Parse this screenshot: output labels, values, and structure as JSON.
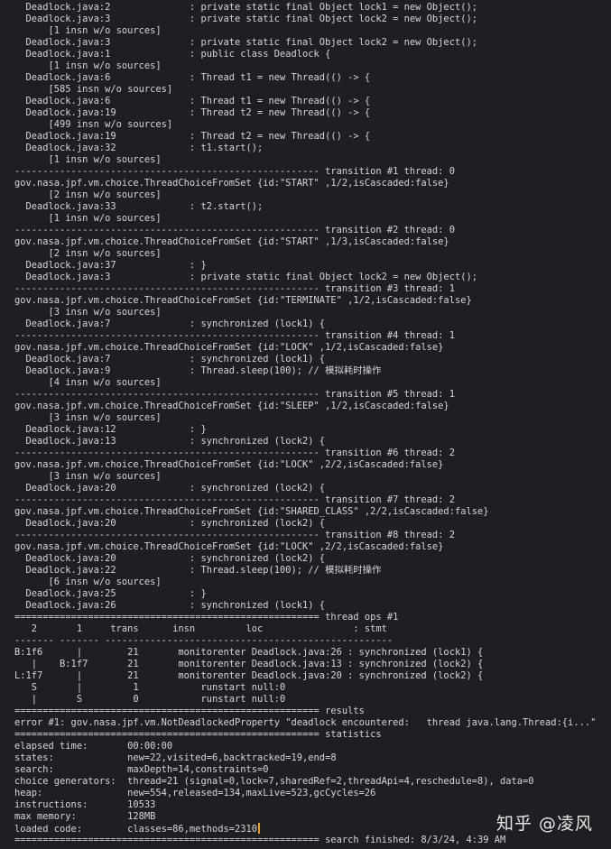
{
  "console": {
    "lines": [
      "  Deadlock.java:2              : private static final Object lock1 = new Object();",
      "  Deadlock.java:3              : private static final Object lock2 = new Object();",
      "      [1 insn w/o sources]",
      "  Deadlock.java:3              : private static final Object lock2 = new Object();",
      "  Deadlock.java:1              : public class Deadlock {",
      "      [1 insn w/o sources]",
      "  Deadlock.java:6              : Thread t1 = new Thread(() -> {",
      "      [585 insn w/o sources]",
      "  Deadlock.java:6              : Thread t1 = new Thread(() -> {",
      "  Deadlock.java:19             : Thread t2 = new Thread(() -> {",
      "      [499 insn w/o sources]",
      "  Deadlock.java:19             : Thread t2 = new Thread(() -> {",
      "  Deadlock.java:32             : t1.start();",
      "      [1 insn w/o sources]",
      "------------------------------------------------------ transition #1 thread: 0",
      "gov.nasa.jpf.vm.choice.ThreadChoiceFromSet {id:\"START\" ,1/2,isCascaded:false}",
      "      [2 insn w/o sources]",
      "  Deadlock.java:33             : t2.start();",
      "      [1 insn w/o sources]",
      "------------------------------------------------------ transition #2 thread: 0",
      "gov.nasa.jpf.vm.choice.ThreadChoiceFromSet {id:\"START\" ,1/3,isCascaded:false}",
      "      [2 insn w/o sources]",
      "  Deadlock.java:37             : }",
      "  Deadlock.java:3              : private static final Object lock2 = new Object();",
      "------------------------------------------------------ transition #3 thread: 1",
      "gov.nasa.jpf.vm.choice.ThreadChoiceFromSet {id:\"TERMINATE\" ,1/2,isCascaded:false}",
      "      [3 insn w/o sources]",
      "  Deadlock.java:7              : synchronized (lock1) {",
      "------------------------------------------------------ transition #4 thread: 1",
      "gov.nasa.jpf.vm.choice.ThreadChoiceFromSet {id:\"LOCK\" ,1/2,isCascaded:false}",
      "  Deadlock.java:7              : synchronized (lock1) {",
      "  Deadlock.java:9              : Thread.sleep(100); // 模拟耗时操作",
      "      [4 insn w/o sources]",
      "------------------------------------------------------ transition #5 thread: 1",
      "gov.nasa.jpf.vm.choice.ThreadChoiceFromSet {id:\"SLEEP\" ,1/2,isCascaded:false}",
      "      [3 insn w/o sources]",
      "  Deadlock.java:12             : }",
      "  Deadlock.java:13             : synchronized (lock2) {",
      "------------------------------------------------------ transition #6 thread: 2",
      "gov.nasa.jpf.vm.choice.ThreadChoiceFromSet {id:\"LOCK\" ,2/2,isCascaded:false}",
      "      [3 insn w/o sources]",
      "  Deadlock.java:20             : synchronized (lock2) {",
      "------------------------------------------------------ transition #7 thread: 2",
      "gov.nasa.jpf.vm.choice.ThreadChoiceFromSet {id:\"SHARED_CLASS\" ,2/2,isCascaded:false}",
      "  Deadlock.java:20             : synchronized (lock2) {",
      "------------------------------------------------------ transition #8 thread: 2",
      "gov.nasa.jpf.vm.choice.ThreadChoiceFromSet {id:\"LOCK\" ,2/2,isCascaded:false}",
      "  Deadlock.java:20             : synchronized (lock2) {",
      "  Deadlock.java:22             : Thread.sleep(100); // 模拟耗时操作",
      "      [6 insn w/o sources]",
      "  Deadlock.java:25             : }",
      "  Deadlock.java:26             : synchronized (lock1) {",
      "====================================================== thread ops #1",
      "   2       1     trans      insn         loc                : stmt",
      "------- ------- ---------------------------------------------------",
      "B:1f6      |        21       monitorenter Deadlock.java:26 : synchronized (lock1) {",
      "   |    B:1f7       21       monitorenter Deadlock.java:13 : synchronized (lock2) {",
      "L:1f7      |        21       monitorenter Deadlock.java:20 : synchronized (lock2) {",
      "   S       |         1           runstart null:0",
      "   |       S         0           runstart null:0",
      "====================================================== results",
      "error #1: gov.nasa.jpf.vm.NotDeadlockedProperty \"deadlock encountered:   thread java.lang.Thread:{i...\"",
      "====================================================== statistics",
      "elapsed time:       00:00:00",
      "states:             new=22,visited=6,backtracked=19,end=8",
      "search:             maxDepth=14,constraints=0",
      "choice generators:  thread=21 (signal=0,lock=7,sharedRef=2,threadApi=4,reschedule=8), data=0",
      "heap:               new=554,released=134,maxLive=523,gcCycles=26",
      "instructions:       10533",
      "max memory:         128MB",
      "loaded code:        classes=86,methods=2310",
      "====================================================== search finished: 8/3/24, 4:39 AM"
    ]
  },
  "watermark": {
    "text": "知乎 @凌风"
  }
}
